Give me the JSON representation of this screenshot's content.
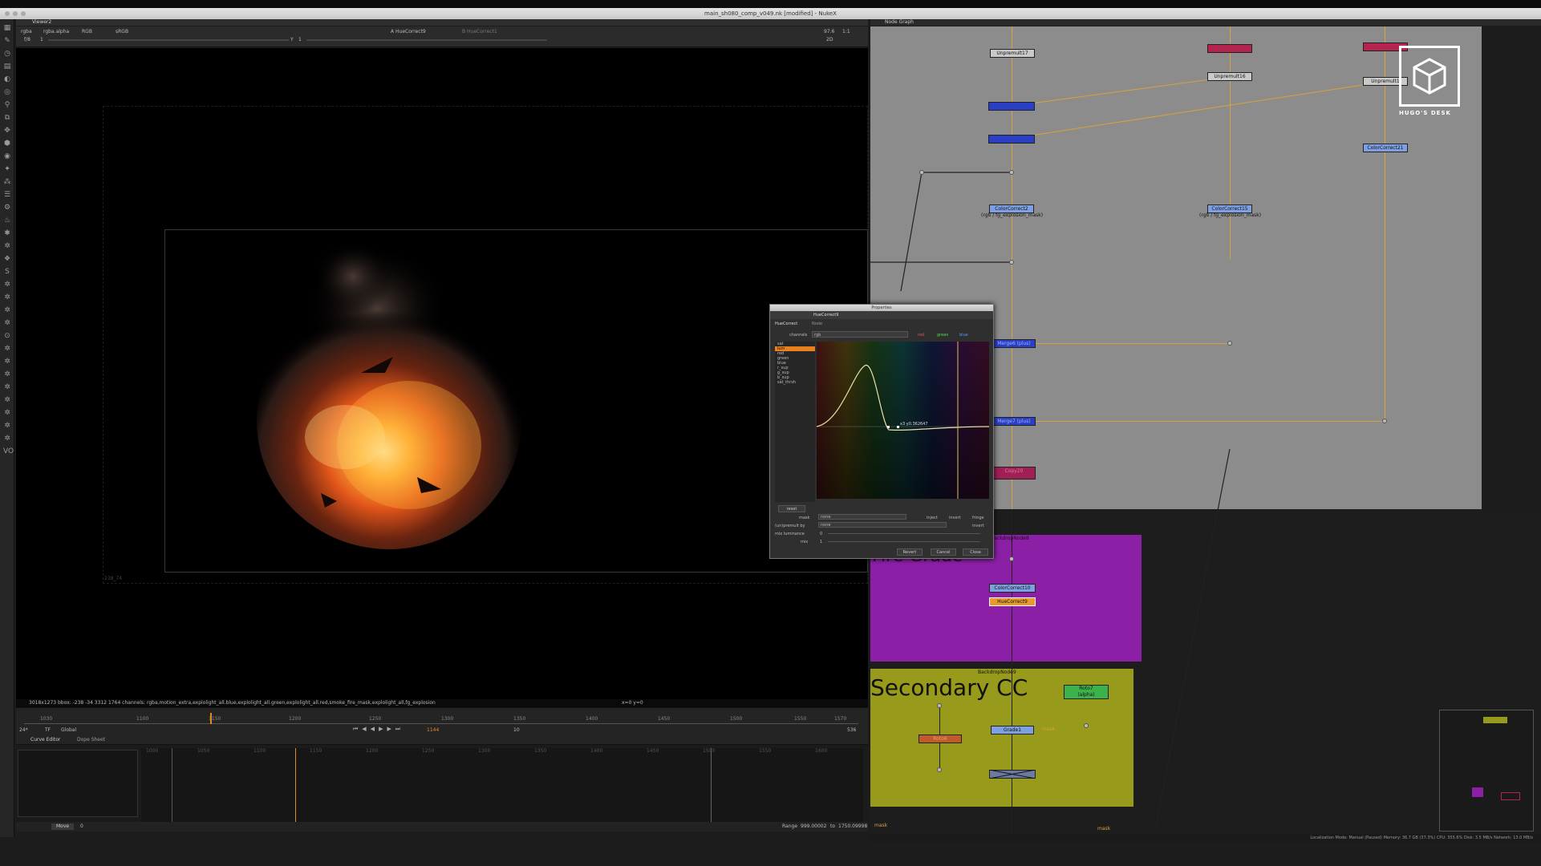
{
  "window": {
    "title": "main_sh080_comp_v049.nk [modified] - NukeX"
  },
  "viewer": {
    "tab": "Viewer2",
    "channel_set": "rgba",
    "alpha_channel": "rgba.alpha",
    "display": "RGB",
    "lut": "sRGB",
    "input_a": "A  HueCorrect9",
    "input_b": "B  HueCorrect1",
    "frame_field": "f/8",
    "gain": "1",
    "gamma_label": "Y",
    "gamma": "1",
    "zoom": "2D",
    "fps": "97.6",
    "ratio": "1:1",
    "crop_label": "238_74",
    "status_line": "3018x1273  bbox: -238 -34 3312 1764 channels: rgba,motion_extra,explolight_all.blue,explolight_all.green,explolight_all.red,smoke_fire_mask,explolight_all,fg_explosion",
    "coords": "x=0 y=0"
  },
  "timeline": {
    "ticks": [
      "1030",
      "1100",
      "1150",
      "1200",
      "1250",
      "1300",
      "1350",
      "1400",
      "1450",
      "1500",
      "1550",
      "1570"
    ],
    "fps_value": "24*",
    "tf_value": "TF",
    "scope": "Global",
    "current_frame": "1144",
    "step": "10",
    "end_frame": "536"
  },
  "curve_editor": {
    "tabs": [
      "Curve Editor",
      "Dope Sheet"
    ],
    "ticks": [
      "1000",
      "1050",
      "1100",
      "1150",
      "1200",
      "1250",
      "1300",
      "1350",
      "1400",
      "1450",
      "1500",
      "1550",
      "1600"
    ],
    "mode": "Move",
    "value": "0",
    "range_label": "Range",
    "range_start": "999.00002",
    "range_to": "to",
    "range_end": "1750.09998"
  },
  "node_graph": {
    "tab": "Node Graph",
    "nodes": {
      "unpremult17": "Unpremult17",
      "unpremult16": "Unpremult16",
      "unpremult_right": "Unpremult1",
      "colorcorrect2": "ColorCorrect2",
      "colorcorrect2_sub": "(rgb / fg_explosion_mask)",
      "colorcorrect15": "ColorCorrect15",
      "colorcorrect15_sub": "(rgb / fg_explosion_mask)",
      "colorcorrect21": "ColorCorrect21",
      "merge_plus": "Merge6 (plus)",
      "merge_plus2": "Merge7 (plus)",
      "copy": "Copy20",
      "colorcorrect10": "ColorCorrect10",
      "huecorrect9": "HueCorrect9",
      "roto7": "Roto7",
      "roto7_sub": "(alpha)",
      "grade1": "Grade1",
      "roto6": "Roto6",
      "merge_mask": "Merge"
    },
    "backdrops": {
      "purple_label": "BackdropNode8",
      "purple_title": "Fire Grade",
      "olive_label": "BackdropNode9",
      "olive_title": "Secondary CC"
    },
    "edge_labels": {
      "mask_left": "mask",
      "mask_right": "mask",
      "mask_mid": "mask"
    },
    "logo_text": "HUGO'S DESK",
    "status_bar": "Localization Mode: Manual (Paused)  Memory: 36.7 GB (37.3%)  CPU: 355.6%  Disk: 3.5 MB/s  Network: 13.0 MB/s"
  },
  "properties": {
    "window_title": "Properties",
    "node_name": "HueCorrect9",
    "tabs": [
      "HueCorrect",
      "Node"
    ],
    "channels_label": "channels",
    "channels_value": "rgb",
    "checks": [
      "red",
      "green",
      "blue"
    ],
    "curves": [
      "sat",
      "lum",
      "red",
      "green",
      "blue",
      "r_sup",
      "g_sup",
      "b_sup",
      "sat_thrsh"
    ],
    "selected_curve": "lum",
    "curve_point_label": "x3 y0.362647",
    "reset_label": "reset",
    "mask_label": "mask",
    "mask_value": "none",
    "inject_label": "inject",
    "invert_label": "invert",
    "fringe_label": "fringe",
    "unpremult_label": "(un)premult by",
    "unpremult_value": "none",
    "invert2_label": "invert",
    "mixlum_label": "mix luminance",
    "mixlum_value": "0",
    "mix_label": "mix",
    "mix_value": "1",
    "buttons": [
      "Revert",
      "Cancel",
      "Close"
    ]
  }
}
